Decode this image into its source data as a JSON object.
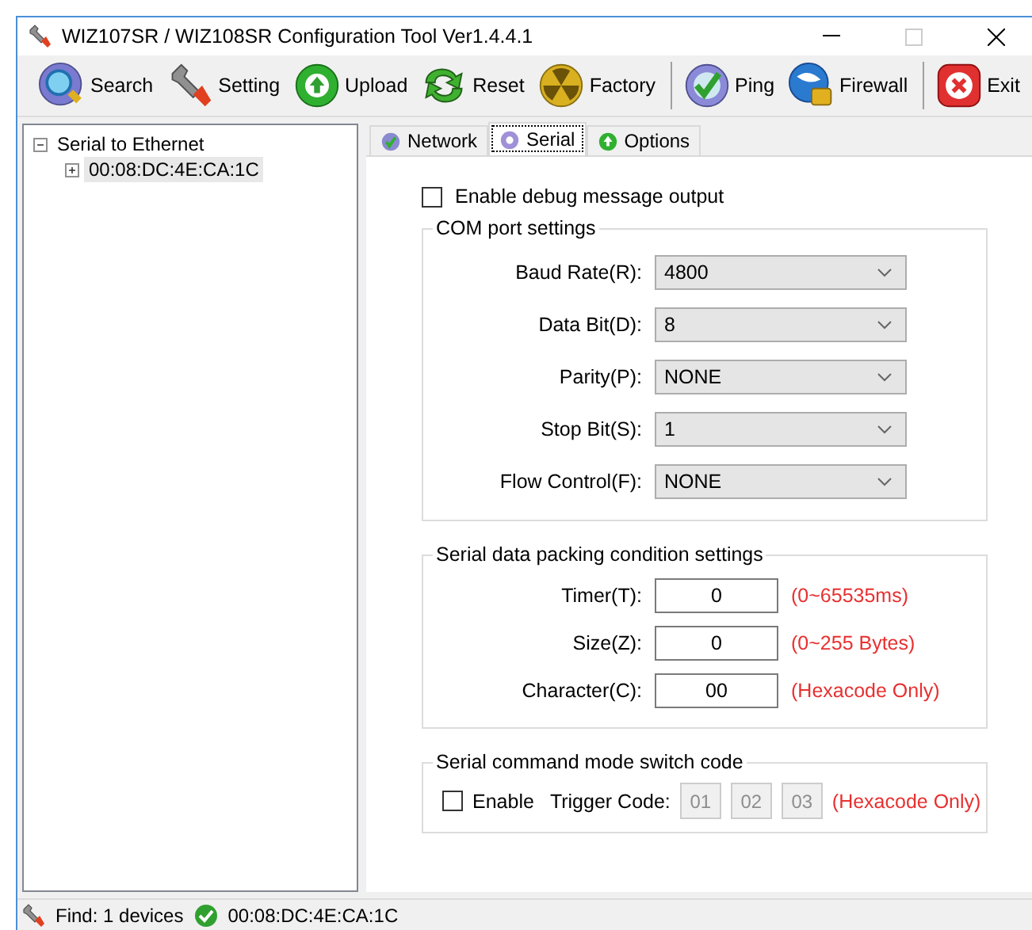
{
  "window": {
    "title": "WIZ107SR / WIZ108SR Configuration Tool Ver1.4.4.1"
  },
  "toolbar": {
    "groups": [
      [
        {
          "label": "Search",
          "kind": "search"
        },
        {
          "label": "Setting",
          "kind": "setting"
        },
        {
          "label": "Upload",
          "kind": "upload"
        },
        {
          "label": "Reset",
          "kind": "reset"
        },
        {
          "label": "Factory",
          "kind": "factory"
        }
      ],
      [
        {
          "label": "Ping",
          "kind": "ping"
        },
        {
          "label": "Firewall",
          "kind": "firewall"
        }
      ],
      [
        {
          "label": "Exit",
          "kind": "exit"
        }
      ]
    ]
  },
  "tree": {
    "label": "Serial to Ethernet",
    "expanded": true,
    "children": [
      {
        "label": "00:08:DC:4E:CA:1C",
        "expanded": false,
        "selected": true
      }
    ]
  },
  "tabs": [
    {
      "label": "Network",
      "kind": "network",
      "selected": false
    },
    {
      "label": "Serial",
      "kind": "serial",
      "selected": true
    },
    {
      "label": "Options",
      "kind": "options",
      "selected": false
    }
  ],
  "debug_output": {
    "label": "Enable debug message output",
    "checked": false
  },
  "com_port": {
    "title": "COM port settings",
    "fields": [
      {
        "label": "Baud Rate(R):",
        "value": "4800"
      },
      {
        "label": "Data Bit(D):",
        "value": "8"
      },
      {
        "label": "Parity(P):",
        "value": "NONE"
      },
      {
        "label": "Stop Bit(S):",
        "value": "1"
      },
      {
        "label": "Flow Control(F):",
        "value": "NONE"
      }
    ]
  },
  "packing": {
    "title": "Serial data packing condition settings",
    "fields": [
      {
        "label": "Timer(T):",
        "value": "0",
        "hint": "(0~65535ms)"
      },
      {
        "label": "Size(Z):",
        "value": "0",
        "hint": "(0~255 Bytes)"
      },
      {
        "label": "Character(C):",
        "value": "00",
        "hint": "(Hexacode Only)"
      }
    ]
  },
  "command_mode": {
    "title": "Serial command mode switch code",
    "enable": {
      "label": "Enable",
      "checked": false
    },
    "trigger_label": "Trigger Code:",
    "codes": [
      {
        "value": "01",
        "disabled": true
      },
      {
        "value": "02",
        "disabled": true
      },
      {
        "value": "03",
        "disabled": true
      }
    ],
    "hint": "(Hexacode Only)"
  },
  "status_bar": {
    "find": "Find: 1 devices",
    "device": "00:08:DC:4E:CA:1C"
  }
}
